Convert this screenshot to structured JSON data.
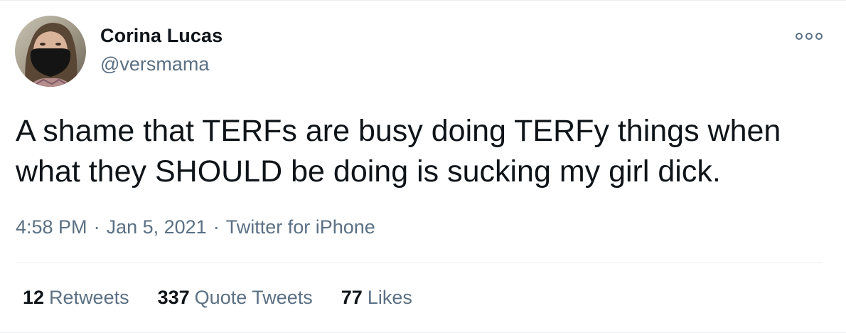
{
  "tweet": {
    "author": {
      "name": "Corina Lucas",
      "handle": "@versmama",
      "avatar": "profile-photo"
    },
    "text_lines": [
      "A shame that TERFs are busy doing TERFy things when",
      "what they SHOULD be doing is sucking my girl dick."
    ],
    "time": "4:58 PM",
    "date": "Jan 5, 2021",
    "source": "Twitter for iPhone",
    "separator": "·",
    "more_icon": "more-options-icon",
    "stats": {
      "retweets": {
        "count": "12",
        "label": "Retweets"
      },
      "quote_tweets": {
        "count": "337",
        "label": "Quote Tweets"
      },
      "likes": {
        "count": "77",
        "label": "Likes"
      }
    },
    "colors": {
      "text": "#0f1419",
      "secondary": "#5b7083",
      "divider": "#e6ecf0"
    }
  }
}
